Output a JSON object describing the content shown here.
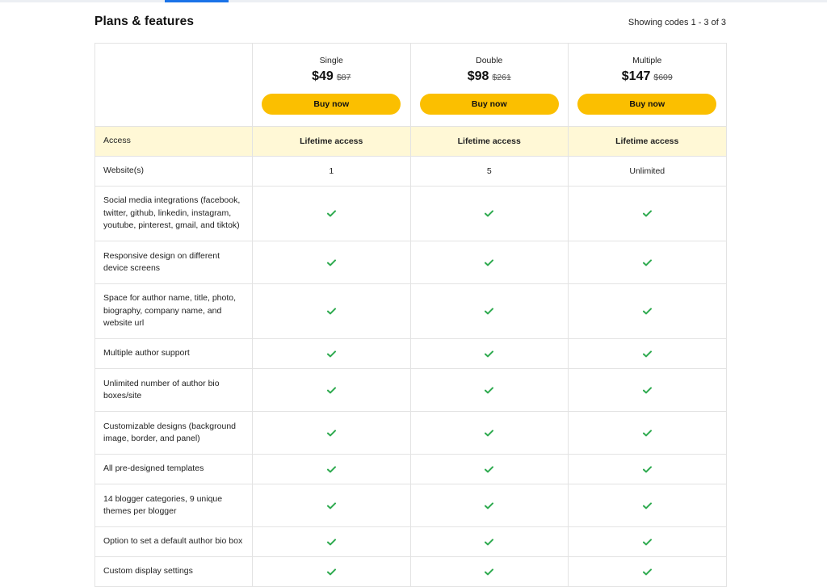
{
  "header": {
    "title": "Plans & features",
    "showing": "Showing codes 1 - 3 of 3"
  },
  "colors": {
    "accent_tab": "#1a73e8",
    "buy_button": "#fbbf00",
    "access_row": "#fff8d6",
    "check": "#2eaa4f"
  },
  "plans": [
    {
      "name": "Single",
      "price": "$49",
      "old_price": "$87",
      "button": "Buy now"
    },
    {
      "name": "Double",
      "price": "$98",
      "old_price": "$261",
      "button": "Buy now"
    },
    {
      "name": "Multiple",
      "price": "$147",
      "old_price": "$609",
      "button": "Buy now"
    }
  ],
  "rows": [
    {
      "feature": "Access",
      "values": [
        "Lifetime access",
        "Lifetime access",
        "Lifetime access"
      ]
    },
    {
      "feature": "Website(s)",
      "values": [
        "1",
        "5",
        "Unlimited"
      ]
    },
    {
      "feature": "Social media integrations (facebook, twitter, github, linkedin, instagram, youtube, pinterest, gmail, and tiktok)",
      "values": [
        "check-icon",
        "check-icon",
        "check-icon"
      ]
    },
    {
      "feature": "Responsive design on different device screens",
      "values": [
        "check-icon",
        "check-icon",
        "check-icon"
      ]
    },
    {
      "feature": "Space for author name, title, photo, biography, company name, and website url",
      "values": [
        "check-icon",
        "check-icon",
        "check-icon"
      ]
    },
    {
      "feature": "Multiple author support",
      "values": [
        "check-icon",
        "check-icon",
        "check-icon"
      ]
    },
    {
      "feature": "Unlimited number of author bio boxes/site",
      "values": [
        "check-icon",
        "check-icon",
        "check-icon"
      ]
    },
    {
      "feature": "Customizable designs (background image, border, and panel)",
      "values": [
        "check-icon",
        "check-icon",
        "check-icon"
      ]
    },
    {
      "feature": "All pre-designed templates",
      "values": [
        "check-icon",
        "check-icon",
        "check-icon"
      ]
    },
    {
      "feature": "14 blogger categories, 9 unique themes per blogger",
      "values": [
        "check-icon",
        "check-icon",
        "check-icon"
      ]
    },
    {
      "feature": "Option to set a default author bio box",
      "values": [
        "check-icon",
        "check-icon",
        "check-icon"
      ]
    },
    {
      "feature": "Custom display settings",
      "values": [
        "check-icon",
        "check-icon",
        "check-icon"
      ]
    }
  ]
}
